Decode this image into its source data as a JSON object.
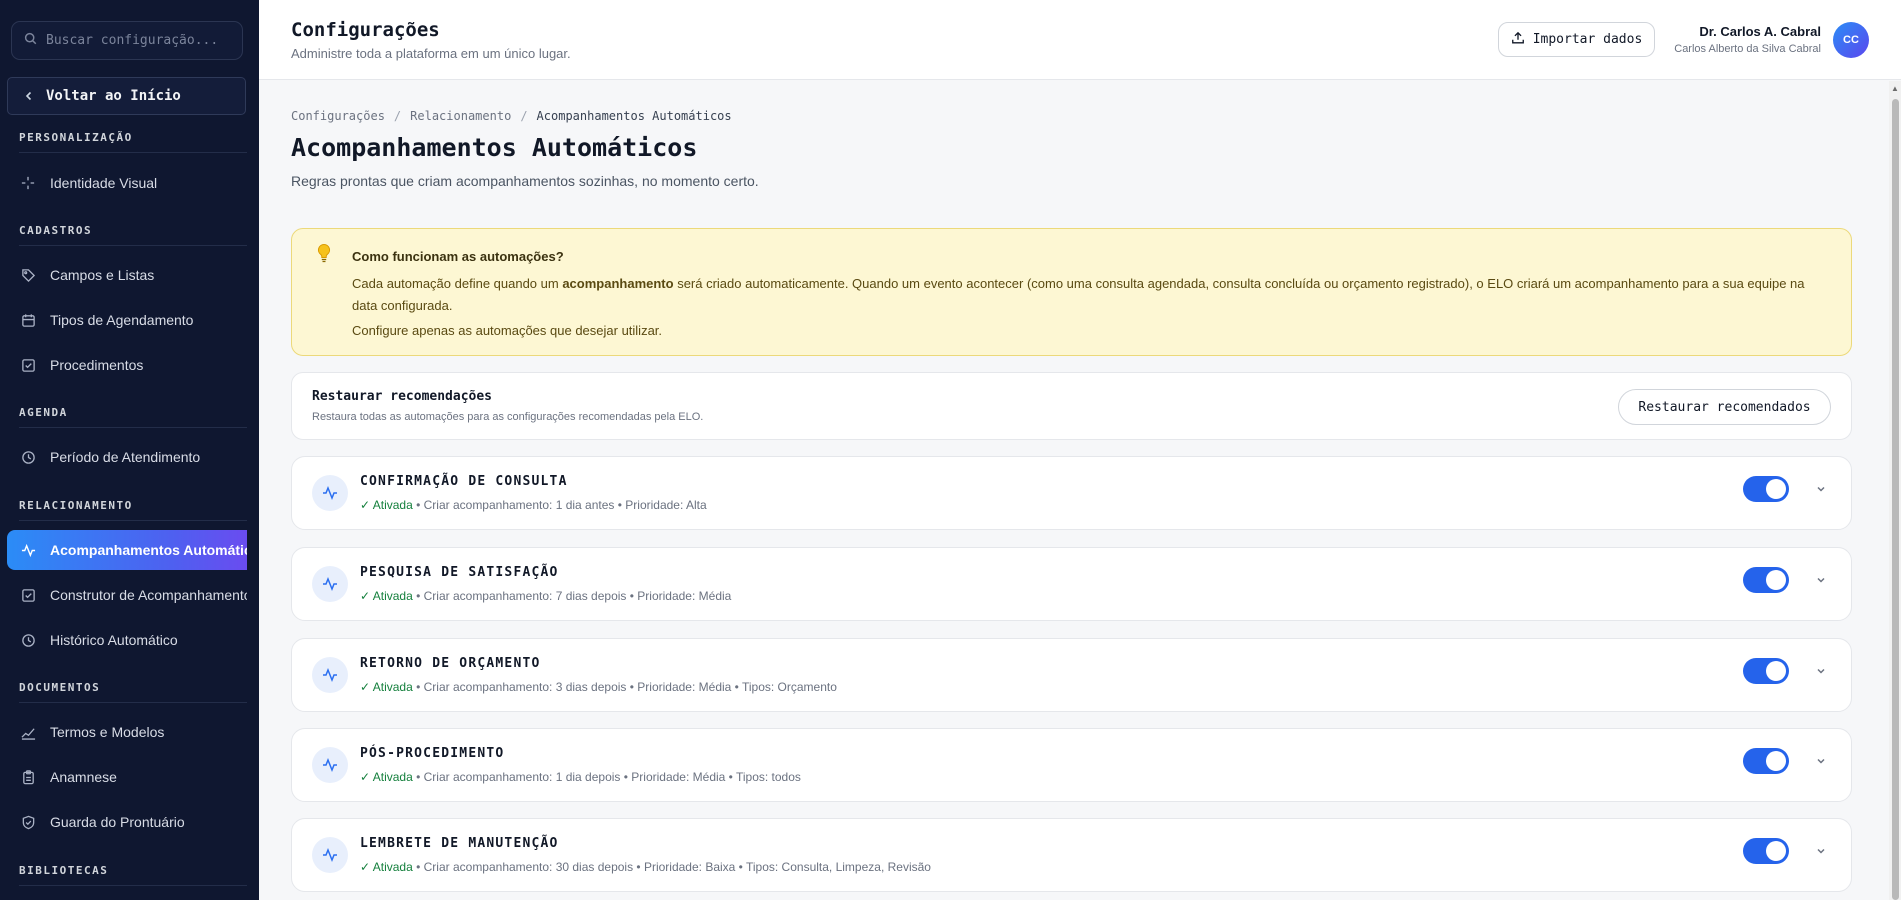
{
  "sidebar": {
    "search_placeholder": "Buscar configuração...",
    "back_label": "Voltar ao Início",
    "sections": {
      "personalizacao": "PERSONALIZAÇÃO",
      "cadastros": "CADASTROS",
      "agenda": "AGENDA",
      "relacionamento": "RELACIONAMENTO",
      "documentos": "DOCUMENTOS",
      "bibliotecas": "BIBLIOTECAS"
    },
    "items": {
      "identidade_visual": "Identidade Visual",
      "campos_listas": "Campos e Listas",
      "tipos_agendamento": "Tipos de Agendamento",
      "procedimentos": "Procedimentos",
      "periodo_atendimento": "Período de Atendimento",
      "acompanhamentos_automaticos": "Acompanhamentos Automáticos",
      "construtor_acompanhamento": "Construtor de Acompanhamento",
      "historico_automatico": "Histórico Automático",
      "termos_modelos": "Termos e Modelos",
      "anamnese": "Anamnese",
      "guarda_prontuario": "Guarda do Prontuário"
    }
  },
  "header": {
    "title": "Configurações",
    "subtitle": "Administre toda a plataforma em um único lugar.",
    "import_label": "Importar dados",
    "user_name": "Dr. Carlos A. Cabral",
    "user_full": "Carlos Alberto da Silva Cabral",
    "avatar_initials": "CC"
  },
  "main": {
    "breadcrumb": [
      "Configurações",
      "Relacionamento",
      "Acompanhamentos Automáticos"
    ],
    "title": "Acompanhamentos Automáticos",
    "subtitle": "Regras prontas que criam acompanhamentos sozinhas, no momento certo.",
    "info": {
      "heading": "Como funcionam as automações?",
      "p1_a": "Cada automação define quando um ",
      "p1_bold": "acompanhamento",
      "p1_b": " será criado automaticamente. Quando um evento acontecer (como uma consulta agendada, consulta concluída ou orçamento registrado), o ELO criará um acompanhamento para a sua equipe na data configurada.",
      "p2": "Configure apenas as automações que desejar utilizar."
    },
    "restore": {
      "heading": "Restaurar recomendações",
      "desc": "Restaura todas as automações para as configurações recomendadas pela ELO.",
      "button": "Restaurar recomendados"
    },
    "automations": [
      {
        "name": "CONFIRMAÇÃO DE CONSULTA",
        "status": "✓ Ativada",
        "detail": " • Criar acompanhamento: 1 dia antes • Prioridade: Alta",
        "enabled": true
      },
      {
        "name": "PESQUISA DE SATISFAÇÃO",
        "status": "✓ Ativada",
        "detail": " • Criar acompanhamento: 7 dias depois • Prioridade: Média",
        "enabled": true
      },
      {
        "name": "RETORNO DE ORÇAMENTO",
        "status": "✓ Ativada",
        "detail": " • Criar acompanhamento: 3 dias depois • Prioridade: Média • Tipos: Orçamento",
        "enabled": true
      },
      {
        "name": "PÓS-PROCEDIMENTO",
        "status": "✓ Ativada",
        "detail": " • Criar acompanhamento: 1 dia depois • Prioridade: Média • Tipos: todos",
        "enabled": true
      },
      {
        "name": "LEMBRETE DE MANUTENÇÃO",
        "status": "✓ Ativada",
        "detail": " • Criar acompanhamento: 30 dias depois • Prioridade: Baixa • Tipos: Consulta, Limpeza, Revisão",
        "enabled": true
      }
    ]
  },
  "colors": {
    "sidebar_bg": "#0f1730",
    "accent": "#2563eb",
    "active_gradient_start": "#2b8cf6",
    "active_gradient_end": "#6a4cf0",
    "info_bg": "#fdf7d3",
    "status_green": "#15803d"
  }
}
